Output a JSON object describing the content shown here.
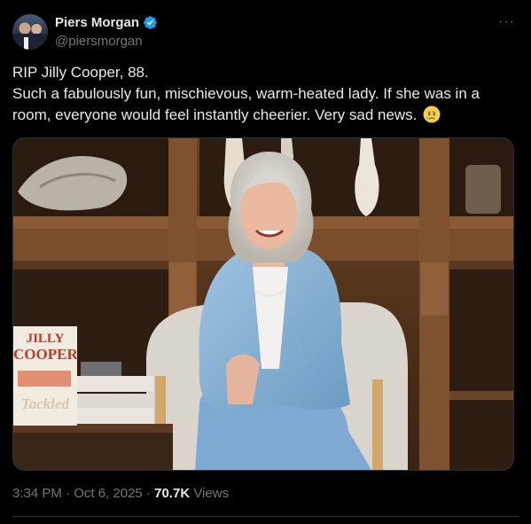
{
  "author": {
    "display_name": "Piers Morgan",
    "handle": "@piersmorgan",
    "verified": true,
    "avatar": "avatar-photo"
  },
  "more_icon": "more-horizontal-icon",
  "tweet": {
    "lines": [
      "RIP Jilly Cooper, 88.",
      "Such a fabulously fun, mischievous, warm-heated lady. If she was in a",
      "room, everyone would feel instantly cheerier. Very sad news."
    ],
    "emoji": "crying-face-emoji"
  },
  "media": {
    "book_cover_title_line1": "JILLY",
    "book_cover_title_line2": "COOPER",
    "book_cover_subtitle": "Tackled"
  },
  "meta": {
    "time": "3:34 PM",
    "date": "Oct 6, 2025",
    "separator": "·",
    "views_count": "70.7K",
    "views_label": "Views"
  },
  "colors": {
    "background": "#000000",
    "text_primary": "#e7e9ea",
    "text_secondary": "#71767b",
    "verified_blue": "#1d9bf0",
    "divider": "#2f3336"
  }
}
